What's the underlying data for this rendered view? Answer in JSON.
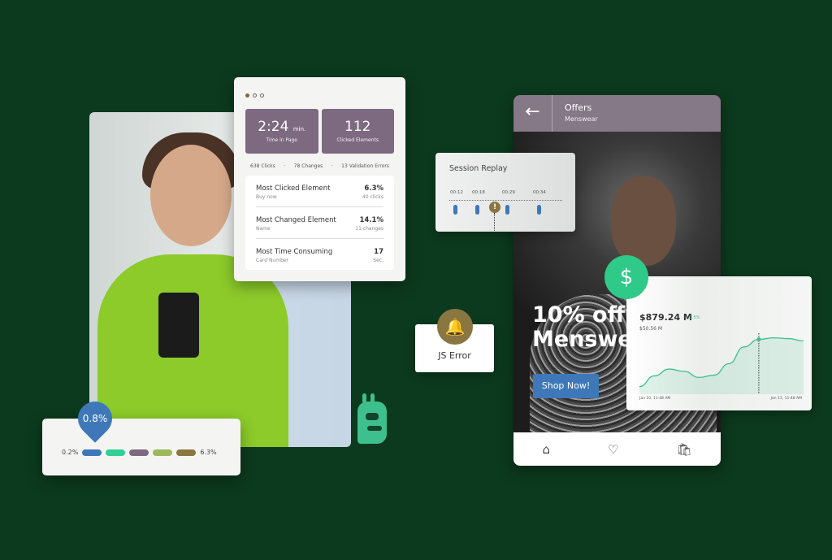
{
  "stats_card": {
    "time_value": "2:24",
    "time_unit": "min.",
    "time_label": "Time in Page",
    "clicked_value": "112",
    "clicked_label": "Clicked Elements",
    "counts": [
      "638 Clicks",
      "78 Changes",
      "13 Validation Errors"
    ],
    "rows": [
      {
        "title": "Most Clicked Element",
        "sub": "Buy now",
        "value": "6.3%",
        "value_sub": "40 clicks"
      },
      {
        "title": "Most Changed Element",
        "sub": "Name",
        "value": "14.1%",
        "value_sub": "11 changes"
      },
      {
        "title": "Most Time Consuming",
        "sub": "Card Number",
        "value": "17",
        "value_sub": "Sec."
      }
    ]
  },
  "legend_card": {
    "pin_value": "0.8%",
    "min_label": "0.2%",
    "max_label": "6.3%",
    "colors": [
      "#3e78b8",
      "#2fd195",
      "#7d6a80",
      "#9cb85a",
      "#8a7641"
    ]
  },
  "js_error": {
    "label": "JS Error",
    "icon": "bell-icon"
  },
  "session_replay": {
    "title": "Session Replay",
    "times": [
      "00:12",
      "00:18",
      "00:29",
      "00:34"
    ],
    "warning_icon": "exclamation-icon"
  },
  "phone": {
    "title": "Offers",
    "subtitle": "Menswear",
    "promo": "10% off\nMenswe",
    "button": "Shop Now!",
    "nav_icons": [
      "home-icon",
      "heart-icon",
      "bag-icon"
    ],
    "header_color": "#857887"
  },
  "revenue_card": {
    "value": "$879.24 M",
    "change": "3.5%",
    "sub_value": "$50.56 M",
    "chart_data": {
      "type": "area",
      "x_labels": [
        "Jan 10, 11:48 AM",
        "Jan 11, 11:48 AM"
      ],
      "values": [
        10,
        24,
        33,
        30,
        22,
        25,
        40,
        62,
        72,
        74,
        73,
        70
      ],
      "highlight_index": 8,
      "color": "#3dbf8e"
    }
  },
  "colors": {
    "background": "#0c3a1e",
    "accent_green": "#2fc98a",
    "accent_blue": "#3e78b8",
    "gold": "#8a7641"
  }
}
